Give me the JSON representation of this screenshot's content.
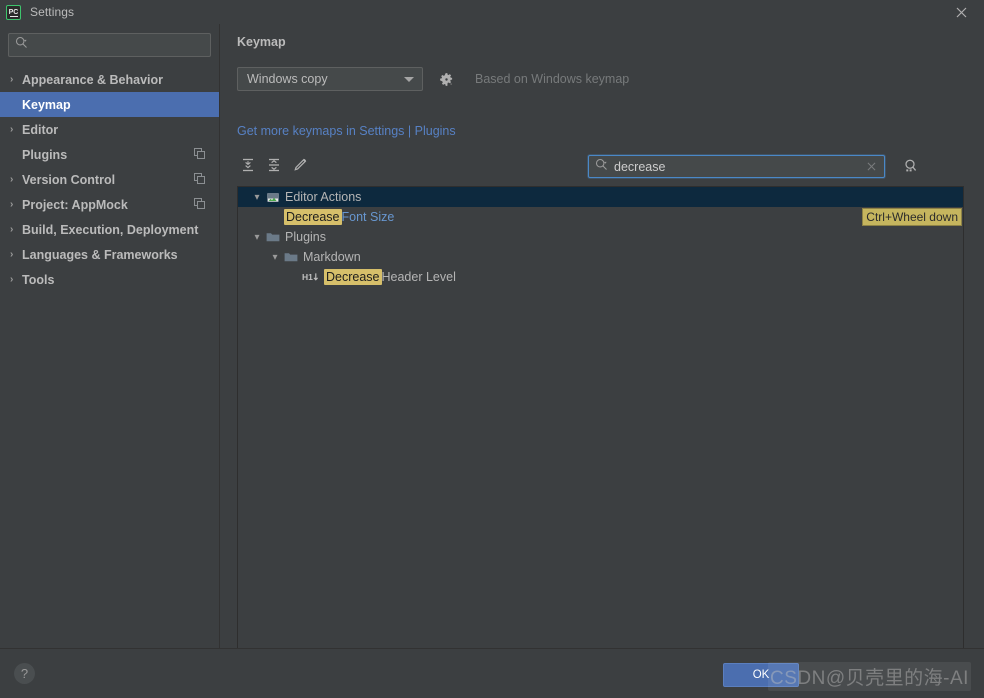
{
  "window": {
    "title": "Settings",
    "app_icon": "pycharm-icon",
    "close_icon": "close-icon"
  },
  "sidebar": {
    "search": {
      "value": "",
      "placeholder": "",
      "icon": "search-icon"
    },
    "items": [
      {
        "label": "Appearance & Behavior",
        "expandable": true,
        "selected": false,
        "badge": false
      },
      {
        "label": "Keymap",
        "expandable": false,
        "selected": true,
        "badge": false
      },
      {
        "label": "Editor",
        "expandable": true,
        "selected": false,
        "badge": false
      },
      {
        "label": "Plugins",
        "expandable": false,
        "selected": false,
        "badge": true
      },
      {
        "label": "Version Control",
        "expandable": true,
        "selected": false,
        "badge": true
      },
      {
        "label": "Project: AppMock",
        "expandable": true,
        "selected": false,
        "badge": true
      },
      {
        "label": "Build, Execution, Deployment",
        "expandable": true,
        "selected": false,
        "badge": false
      },
      {
        "label": "Languages & Frameworks",
        "expandable": true,
        "selected": false,
        "badge": false
      },
      {
        "label": "Tools",
        "expandable": true,
        "selected": false,
        "badge": false
      }
    ]
  },
  "main": {
    "title": "Keymap",
    "keymap_select": {
      "value": "Windows copy",
      "options": [
        "Windows copy"
      ]
    },
    "gear_icon": "gear-icon",
    "based_on": "Based on Windows keymap",
    "more_keymaps_link": "Get more keymaps in Settings | Plugins",
    "toolbar": [
      {
        "name": "expand-all-icon",
        "title": "Expand All"
      },
      {
        "name": "collapse-all-icon",
        "title": "Collapse All"
      },
      {
        "name": "edit-shortcut-icon",
        "title": "Edit Shortcut"
      }
    ],
    "search": {
      "value": "decrease",
      "placeholder": "",
      "icon": "search-icon",
      "clear_icon": "clear-icon"
    },
    "find_by_shortcut_icon": "find-by-shortcut-icon",
    "tree": [
      {
        "label": "Editor Actions",
        "icon": "editor-actions-icon",
        "indent": 0,
        "twisty": "expanded",
        "selected": true,
        "highlight": "",
        "shortcut": ""
      },
      {
        "label": " Font Size",
        "icon": "",
        "indent": 2,
        "twisty": "none",
        "selected": false,
        "highlight": "Decrease",
        "shortcut": "Ctrl+Wheel down"
      },
      {
        "label": "Plugins",
        "icon": "folder-icon",
        "indent": 0,
        "twisty": "expanded",
        "selected": false,
        "highlight": "",
        "shortcut": ""
      },
      {
        "label": "Markdown",
        "icon": "folder-icon",
        "indent": 1,
        "twisty": "expanded",
        "selected": false,
        "highlight": "",
        "shortcut": ""
      },
      {
        "label": " Header Level",
        "icon": "h1-down-icon",
        "indent": 2,
        "twisty": "none",
        "selected": false,
        "highlight": "Decrease",
        "shortcut": ""
      }
    ]
  },
  "footer": {
    "help_label": "?",
    "ok_label": "OK",
    "watermark": "CSDN@贝壳里的海-AI"
  },
  "colors": {
    "background": "#3c3f41",
    "selection_blue": "#4b6eaf",
    "tree_selection": "#0d293e",
    "highlight_yellow": "#d6bf6a",
    "link_blue": "#5781c4",
    "focus_border": "#4a88c7"
  }
}
